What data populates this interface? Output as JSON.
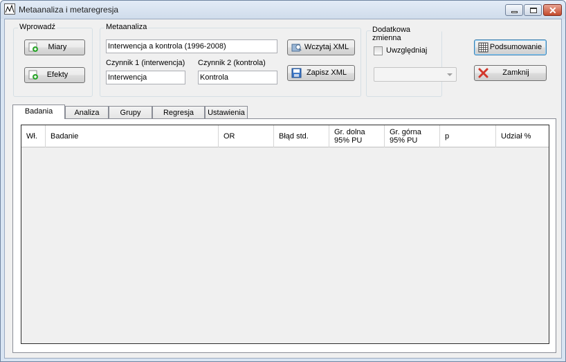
{
  "window": {
    "title": "Metaanaliza i metaregresja"
  },
  "wprowadz": {
    "label": "Wprowadź",
    "miary_label": "Miary",
    "efekty_label": "Efekty"
  },
  "metaanaliza": {
    "label": "Metaanaliza",
    "title_value": "Interwencja a kontrola (1996-2008)",
    "factor1_label": "Czynnik 1 (interwencja)",
    "factor1_value": "Interwencja",
    "factor2_label": "Czynnik 2 (kontrola)",
    "factor2_value": "Kontrola",
    "load_xml_label": "Wczytaj XML",
    "save_xml_label": "Zapisz XML"
  },
  "extra_variable": {
    "label": "Dodatkowa zmienna",
    "checkbox_label": "Uwzględniaj",
    "checked": false,
    "combo_value": ""
  },
  "actions": {
    "summary_label": "Podsumowanie",
    "close_label": "Zamknij"
  },
  "tabs": [
    {
      "label": "Badania",
      "active": true
    },
    {
      "label": "Analiza",
      "active": false
    },
    {
      "label": "Grupy",
      "active": false
    },
    {
      "label": "Regresja",
      "active": false
    },
    {
      "label": "Ustawienia",
      "active": false
    }
  ],
  "grid": {
    "columns": [
      {
        "line1": "Wł.",
        "line2": ""
      },
      {
        "line1": "Badanie",
        "line2": ""
      },
      {
        "line1": "OR",
        "line2": ""
      },
      {
        "line1": "Błąd std.",
        "line2": ""
      },
      {
        "line1": "Gr. dolna",
        "line2": "95% PU"
      },
      {
        "line1": "Gr. górna",
        "line2": "95% PU"
      },
      {
        "line1": "p",
        "line2": ""
      },
      {
        "line1": "Udział %",
        "line2": ""
      }
    ],
    "rows": []
  },
  "colors": {
    "accent_border": "#3c7fb1",
    "close_red": "#c34a2c"
  },
  "icons": {
    "app": "chart-window-icon",
    "miary": "add-green-icon",
    "efekty": "add-green-icon",
    "load_xml": "open-folder-icon",
    "save_xml": "floppy-disk-icon",
    "summary": "table-grid-icon",
    "close": "red-x-icon"
  }
}
